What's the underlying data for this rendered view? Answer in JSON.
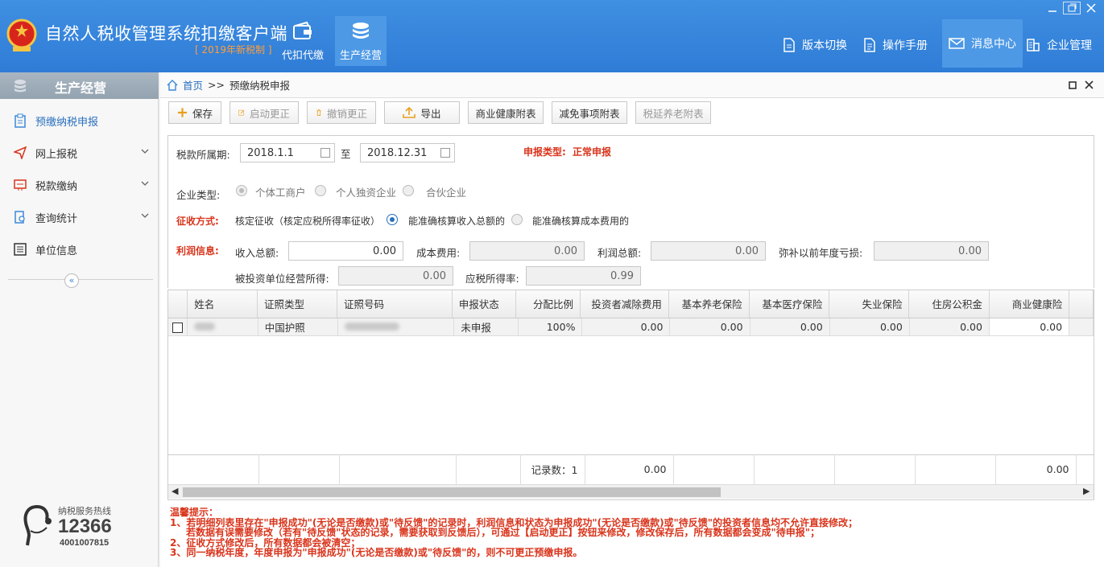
{
  "app": {
    "title": "自然人税收管理系统扣缴客户端",
    "edition": "[ 2019年新税制 ]",
    "top_nav": [
      {
        "label": "代扣代缴",
        "icon": "wallet-icon"
      },
      {
        "label": "生产经营",
        "icon": "coin-stack-icon",
        "active": true
      }
    ],
    "right_nav": [
      {
        "label": "版本切换",
        "icon": "document-icon"
      },
      {
        "label": "操作手册",
        "icon": "manual-icon"
      },
      {
        "label": "消息中心",
        "icon": "mail-icon",
        "active": true
      },
      {
        "label": "企业管理",
        "icon": "building-icon"
      }
    ]
  },
  "sidebar": {
    "title": "生产经营",
    "items": [
      {
        "label": "预缴纳税申报",
        "icon": "clipboard-icon",
        "active": true
      },
      {
        "label": "网上报税",
        "icon": "paper-plane-icon",
        "expandable": true
      },
      {
        "label": "税款缴纳",
        "icon": "payment-icon",
        "expandable": true
      },
      {
        "label": "查询统计",
        "icon": "search-doc-icon",
        "expandable": true
      },
      {
        "label": "单位信息",
        "icon": "list-icon"
      }
    ],
    "collapse_glyph": "«",
    "hotline_label": "纳税服务热线",
    "hotline_number": "12366",
    "hotline_alt": "4001007815"
  },
  "breadcrumb": {
    "home": "首页",
    "separator": ">>",
    "current": "预缴纳税申报"
  },
  "toolbar": {
    "save": "保存",
    "start_correction": "启动更正",
    "cancel_correction": "撤销更正",
    "export": "导出",
    "health_attach": "商业健康附表",
    "relief_attach": "减免事项附表",
    "pension_attach": "税延养老附表"
  },
  "form": {
    "period_label": "税款所属期:",
    "period_from": "2018.1.1",
    "period_to_label": "至",
    "period_to": "2018.12.31",
    "declare_type_label": "申报类型:",
    "declare_type_value": "正常申报",
    "enterprise_type_label": "企业类型:",
    "enterprise_types": [
      "个体工商户",
      "个人独资企业",
      "合伙企业"
    ],
    "collection_label": "征收方式:",
    "collection_method": "核定征收（核定应税所得率征收）",
    "collection_options": [
      "能准确核算收入总额的",
      "能准确核算成本费用的"
    ],
    "profit_label": "利润信息:",
    "income_label": "收入总额:",
    "income_value": "0.00",
    "cost_label": "成本费用:",
    "cost_value": "0.00",
    "profit_total_label": "利润总额:",
    "profit_total_value": "0.00",
    "loss_label": "弥补以前年度亏损:",
    "loss_value": "0.00",
    "invested_label": "被投资单位经营所得:",
    "invested_value": "0.00",
    "rate_label": "应税所得率:",
    "rate_value": "0.99"
  },
  "grid": {
    "columns": [
      "姓名",
      "证照类型",
      "证照号码",
      "申报状态",
      "分配比例",
      "投资者减除费用",
      "基本养老保险",
      "基本医疗保险",
      "失业保险",
      "住房公积金",
      "商业健康险"
    ],
    "rows": [
      {
        "name": "",
        "id_type": "中国护照",
        "id_number": "",
        "status": "未申报",
        "ratio": "100%",
        "investor_deduction": "0.00",
        "pension": "0.00",
        "medical": "0.00",
        "unemployment": "0.00",
        "housing_fund": "0.00",
        "health": "0.00"
      }
    ],
    "footer": {
      "count_label": "记录数：1",
      "investor_deduction_total": "0.00",
      "health_total": "0.00"
    }
  },
  "notes": {
    "title": "温馨提示：",
    "lines": [
      "1、若明细列表里存在\"申报成功\"(无论是否缴款)或\"待反馈\"的记录时，利润信息和状态为申报成功\"(无论是否缴款)或\"待反馈\"的投资者信息均不允许直接修改；",
      "若数据有误需要修改（若有\"待反馈\"状态的记录，需要获取到反馈后），可通过【启动更正】按钮来修改，修改保存后，所有数据都会变成\"待申报\"；",
      "2、征收方式修改后，所有数据都会被清空；",
      "3、同一纳税年度，年度申报为\"申报成功\"(无论是否缴款)或\"待反馈\"的，则不可更正预缴申报。"
    ]
  },
  "colors": {
    "header": "#2f7cd6",
    "accent": "#2a6fbf",
    "warning": "#d9341b",
    "edition": "#ff9d3c"
  }
}
